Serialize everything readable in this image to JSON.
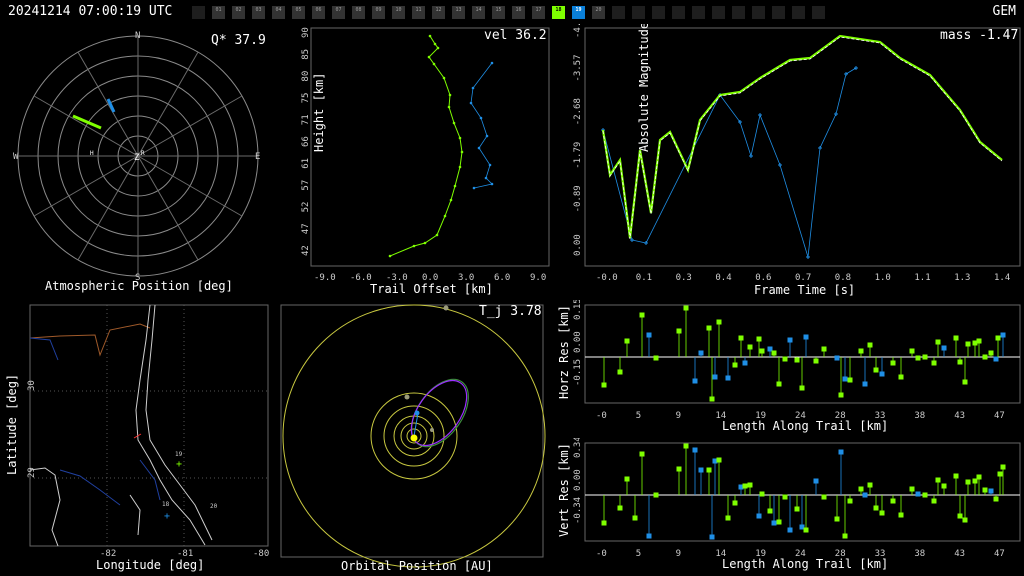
{
  "header": {
    "timestamp": "20241214 07:00:19 UTC",
    "shower": "GEM",
    "cameras": [
      "",
      "01",
      "02",
      "03",
      "04",
      "05",
      "06",
      "07",
      "08",
      "09",
      "10",
      "11",
      "12",
      "13",
      "14",
      "15",
      "16",
      "17",
      "18",
      "19",
      "20",
      "",
      "",
      "",
      "",
      "",
      "",
      "",
      "",
      "",
      "",
      ""
    ],
    "camera_states": [
      "off",
      "on",
      "on",
      "on",
      "on",
      "on",
      "on",
      "on",
      "on",
      "on",
      "on",
      "on",
      "on",
      "on",
      "on",
      "on",
      "on",
      "on",
      "green",
      "blue",
      "on",
      "off",
      "off",
      "off",
      "off",
      "off",
      "off",
      "off",
      "off",
      "off",
      "off",
      "off"
    ]
  },
  "atmos": {
    "q_label": "Q* 37.9",
    "title": "Atmospheric Position [deg]",
    "compass": {
      "n": "N",
      "s": "S",
      "e": "E",
      "w": "W",
      "z": "Z",
      "r": "R",
      "h": "H"
    }
  },
  "trail": {
    "vel_label": "vel 36.2",
    "xlabel": "Trail Offset [km]",
    "ylabel": "Height [km]",
    "xticks": [
      "-9.0",
      "-6.0",
      "-3.0",
      "0.0",
      "3.0",
      "6.0",
      "9.0"
    ],
    "yticks": [
      "90",
      "85",
      "80",
      "75",
      "71",
      "66",
      "61",
      "57",
      "52",
      "47",
      "42"
    ]
  },
  "mag": {
    "mass_label": "mass -1.47",
    "xlabel": "Frame Time [s]",
    "ylabel": "Absolute Magnitude",
    "xticks": [
      "-0.0",
      "0.1",
      "0.3",
      "0.4",
      "0.6",
      "0.7",
      "0.8",
      "1.0",
      "1.1",
      "1.3",
      "1.4"
    ],
    "yticks": [
      "-4.47",
      "-3.57",
      "-2.68",
      "-1.79",
      "-0.89",
      "0.00"
    ]
  },
  "map": {
    "xlabel": "Longitude [deg]",
    "ylabel": "Latitude [deg]",
    "xticks": [
      "-82",
      "-81",
      "-80"
    ],
    "yticks": [
      "30",
      "29"
    ],
    "station_labels": [
      "19",
      "18",
      "20"
    ]
  },
  "orbit": {
    "tj_label": "T_j 3.78",
    "title": "Orbital Position [AU]"
  },
  "horz": {
    "ylabel": "Horz Res [km]",
    "xlabel": "Length Along Trail [km]",
    "xticks": [
      "-0",
      "5",
      "9",
      "14",
      "19",
      "24",
      "28",
      "33",
      "38",
      "43",
      "47"
    ],
    "yticks": [
      "0.15",
      "0.00",
      "-0.15"
    ]
  },
  "vert": {
    "ylabel": "Vert Res [km]",
    "xlabel": "Length Along Trail [km]",
    "xticks": [
      "-0",
      "5",
      "9",
      "14",
      "19",
      "24",
      "28",
      "33",
      "38",
      "43",
      "47"
    ],
    "yticks": [
      "0.34",
      "0.00",
      "-0.34"
    ]
  },
  "colors": {
    "green": "#7fff00",
    "blue": "#1f8fe6",
    "grey": "#6a6a6a",
    "yellow": "#ffff55",
    "purple": "#9b30ff"
  }
}
